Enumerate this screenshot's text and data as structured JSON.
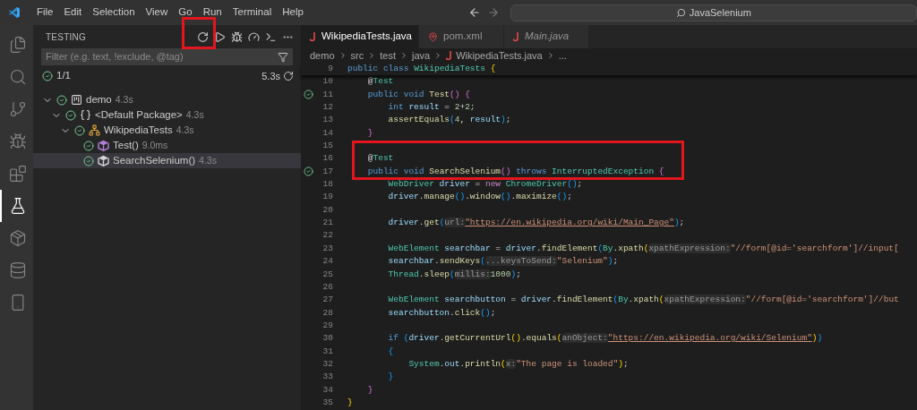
{
  "title_bar": {
    "menu": [
      "File",
      "Edit",
      "Selection",
      "View",
      "Go",
      "Run",
      "Terminal",
      "Help"
    ],
    "command_center": "JavaSelenium"
  },
  "activity_bar": [
    {
      "kind": "explorer",
      "selected": false
    },
    {
      "kind": "search",
      "selected": false
    },
    {
      "kind": "source-control",
      "selected": false
    },
    {
      "kind": "run-debug",
      "selected": false
    },
    {
      "kind": "extensions",
      "selected": false
    },
    {
      "kind": "testing",
      "selected": true
    },
    {
      "kind": "package",
      "selected": false
    },
    {
      "kind": "database",
      "selected": false
    },
    {
      "kind": "device",
      "selected": false
    }
  ],
  "sidebar": {
    "title": "TESTING",
    "actions": [
      {
        "kind": "refresh"
      },
      {
        "kind": "run"
      },
      {
        "kind": "debug"
      },
      {
        "kind": "coverage"
      },
      {
        "kind": "terminal"
      },
      {
        "kind": "more"
      }
    ],
    "filter": {
      "placeholder": "Filter (e.g. text, !exclude, @tag)"
    },
    "summary": {
      "count": "1/1",
      "duration": "5.3s"
    },
    "tree": [
      {
        "kind": "project",
        "label": "demo",
        "duration": "4.3s",
        "passed": true,
        "expanded": true,
        "selected": false,
        "children": [
          {
            "kind": "package",
            "label": "<Default Package>",
            "duration": "4.3s",
            "passed": true,
            "expanded": true,
            "selected": false,
            "children": [
              {
                "kind": "class",
                "label": "WikipediaTests",
                "duration": "4.3s",
                "passed": true,
                "expanded": true,
                "selected": false,
                "children": [
                  {
                    "kind": "method",
                    "label": "Test()",
                    "duration": "9.0ms",
                    "passed": true,
                    "selected": false,
                    "color": "#b180d7"
                  },
                  {
                    "kind": "method",
                    "label": "SearchSelenium()",
                    "duration": "4.3s",
                    "passed": true,
                    "selected": true,
                    "color": "#d4d4d4"
                  }
                ]
              }
            ]
          }
        ]
      }
    ]
  },
  "tabs": [
    {
      "kind": "java",
      "label": "WikipediaTests.java",
      "selected": true,
      "preview": false
    },
    {
      "kind": "xml",
      "label": "pom.xml",
      "selected": false,
      "preview": false
    },
    {
      "kind": "java",
      "label": "Main.java",
      "selected": false,
      "preview": true
    }
  ],
  "breadcrumb": [
    {
      "kind": "folder",
      "label": "demo"
    },
    {
      "kind": "folder",
      "label": "src"
    },
    {
      "kind": "folder",
      "label": "test"
    },
    {
      "kind": "folder",
      "label": "java"
    },
    {
      "kind": "java",
      "label": "WikipediaTests.java"
    },
    {
      "kind": "more",
      "label": "..."
    }
  ],
  "sticky_line": {
    "number": "9",
    "tokens": [
      {
        "kind": "keyword",
        "text": "public"
      },
      {
        "kind": "keyword",
        "text": " class"
      },
      {
        "kind": "type",
        "text": " WikipediaTests"
      },
      {
        "kind": "bracket1",
        "text": " {"
      }
    ]
  },
  "code_lines": [
    {
      "number": "10",
      "passed": false,
      "tokens": [
        {
          "kind": "punct",
          "text": "    @"
        },
        {
          "kind": "type",
          "text": "Test"
        }
      ]
    },
    {
      "number": "11",
      "passed": true,
      "tokens": [
        {
          "kind": "keyword",
          "text": "    public"
        },
        {
          "kind": "keyword",
          "text": " void"
        },
        {
          "kind": "function",
          "text": " Test"
        },
        {
          "kind": "bracket2",
          "text": "()"
        },
        {
          "kind": "bracket2",
          "text": " {"
        }
      ]
    },
    {
      "number": "12",
      "passed": false,
      "tokens": [
        {
          "kind": "keyword",
          "text": "        int"
        },
        {
          "kind": "variable",
          "text": " result"
        },
        {
          "kind": "punct",
          "text": " ="
        },
        {
          "kind": "number",
          "text": " 2"
        },
        {
          "kind": "punct",
          "text": "+"
        },
        {
          "kind": "number",
          "text": "2"
        },
        {
          "kind": "punct",
          "text": ";"
        }
      ]
    },
    {
      "number": "13",
      "passed": false,
      "tokens": [
        {
          "kind": "function",
          "text": "        assertEquals"
        },
        {
          "kind": "bracket3",
          "text": "("
        },
        {
          "kind": "number",
          "text": "4"
        },
        {
          "kind": "punct",
          "text": ","
        },
        {
          "kind": "variable",
          "text": " result"
        },
        {
          "kind": "bracket3",
          "text": ")"
        },
        {
          "kind": "punct",
          "text": ";"
        }
      ]
    },
    {
      "number": "14",
      "passed": false,
      "tokens": [
        {
          "kind": "bracket2",
          "text": "    }"
        }
      ]
    },
    {
      "number": "15",
      "passed": false
    },
    {
      "number": "16",
      "passed": false,
      "tokens": [
        {
          "kind": "punct",
          "text": "    @"
        },
        {
          "kind": "type",
          "text": "Test"
        }
      ]
    },
    {
      "number": "17",
      "passed": true,
      "tokens": [
        {
          "kind": "keyword",
          "text": "    public"
        },
        {
          "kind": "keyword",
          "text": " void"
        },
        {
          "kind": "function",
          "text": " SearchSelenium"
        },
        {
          "kind": "bracket2",
          "text": "()"
        },
        {
          "kind": "keyword",
          "text": " throws"
        },
        {
          "kind": "type",
          "text": " InterruptedException"
        },
        {
          "kind": "bracket2",
          "text": " {"
        }
      ]
    },
    {
      "number": "18",
      "passed": false,
      "tokens": [
        {
          "kind": "type",
          "text": "        WebDriver"
        },
        {
          "kind": "variable",
          "text": " driver"
        },
        {
          "kind": "punct",
          "text": " ="
        },
        {
          "kind": "control",
          "text": " new"
        },
        {
          "kind": "type",
          "text": " ChromeDriver"
        },
        {
          "kind": "bracket3",
          "text": "()"
        },
        {
          "kind": "punct",
          "text": ";"
        }
      ]
    },
    {
      "number": "19",
      "passed": false,
      "tokens": [
        {
          "kind": "variable",
          "text": "        driver"
        },
        {
          "kind": "punct",
          "text": "."
        },
        {
          "kind": "function",
          "text": "manage"
        },
        {
          "kind": "bracket3",
          "text": "()"
        },
        {
          "kind": "punct",
          "text": "."
        },
        {
          "kind": "function",
          "text": "window"
        },
        {
          "kind": "bracket3",
          "text": "()"
        },
        {
          "kind": "punct",
          "text": "."
        },
        {
          "kind": "function",
          "text": "maximize"
        },
        {
          "kind": "bracket3",
          "text": "()"
        },
        {
          "kind": "punct",
          "text": ";"
        }
      ]
    },
    {
      "number": "20",
      "passed": false
    },
    {
      "number": "21",
      "passed": false,
      "tokens": [
        {
          "kind": "variable",
          "text": "        driver"
        },
        {
          "kind": "punct",
          "text": "."
        },
        {
          "kind": "function",
          "text": "get"
        },
        {
          "kind": "bracket3",
          "text": "("
        },
        {
          "kind": "hint",
          "text": "url:"
        },
        {
          "kind": "link",
          "text": "\"https://en.wikipedia.org/wiki/Main_Page\""
        },
        {
          "kind": "bracket3",
          "text": ")"
        },
        {
          "kind": "punct",
          "text": ";"
        }
      ]
    },
    {
      "number": "22",
      "passed": false
    },
    {
      "number": "23",
      "passed": false,
      "tokens": [
        {
          "kind": "type",
          "text": "        WebElement"
        },
        {
          "kind": "variable",
          "text": " searchbar"
        },
        {
          "kind": "punct",
          "text": " ="
        },
        {
          "kind": "variable",
          "text": " driver"
        },
        {
          "kind": "punct",
          "text": "."
        },
        {
          "kind": "function",
          "text": "findElement"
        },
        {
          "kind": "bracket3",
          "text": "("
        },
        {
          "kind": "type",
          "text": "By"
        },
        {
          "kind": "punct",
          "text": "."
        },
        {
          "kind": "function",
          "text": "xpath"
        },
        {
          "kind": "bracket1",
          "text": "("
        },
        {
          "kind": "hint",
          "text": "xpathExpression:"
        },
        {
          "kind": "string",
          "text": "\"//form[@id='searchform']//input["
        }
      ]
    },
    {
      "number": "24",
      "passed": false,
      "tokens": [
        {
          "kind": "variable",
          "text": "        searchbar"
        },
        {
          "kind": "punct",
          "text": "."
        },
        {
          "kind": "function",
          "text": "sendKeys"
        },
        {
          "kind": "bracket3",
          "text": "("
        },
        {
          "kind": "hint",
          "text": "...keysToSend:"
        },
        {
          "kind": "string",
          "text": "\"Selenium\""
        },
        {
          "kind": "bracket3",
          "text": ")"
        },
        {
          "kind": "punct",
          "text": ";"
        }
      ]
    },
    {
      "number": "25",
      "passed": false,
      "tokens": [
        {
          "kind": "type",
          "text": "        Thread"
        },
        {
          "kind": "punct",
          "text": "."
        },
        {
          "kind": "function",
          "text": "sleep"
        },
        {
          "kind": "bracket3",
          "text": "("
        },
        {
          "kind": "hint",
          "text": "millis:"
        },
        {
          "kind": "number",
          "text": "1000"
        },
        {
          "kind": "bracket3",
          "text": ")"
        },
        {
          "kind": "punct",
          "text": ";"
        }
      ]
    },
    {
      "number": "26",
      "passed": false
    },
    {
      "number": "27",
      "passed": false,
      "tokens": [
        {
          "kind": "type",
          "text": "        WebElement"
        },
        {
          "kind": "variable",
          "text": " searchbutton"
        },
        {
          "kind": "punct",
          "text": " ="
        },
        {
          "kind": "variable",
          "text": " driver"
        },
        {
          "kind": "punct",
          "text": "."
        },
        {
          "kind": "function",
          "text": "findElement"
        },
        {
          "kind": "bracket3",
          "text": "("
        },
        {
          "kind": "type",
          "text": "By"
        },
        {
          "kind": "punct",
          "text": "."
        },
        {
          "kind": "function",
          "text": "xpath"
        },
        {
          "kind": "bracket1",
          "text": "("
        },
        {
          "kind": "hint",
          "text": "xpathExpression:"
        },
        {
          "kind": "string",
          "text": "\"//form[@id='searchform']//but"
        }
      ]
    },
    {
      "number": "28",
      "passed": false,
      "tokens": [
        {
          "kind": "variable",
          "text": "        searchbutton"
        },
        {
          "kind": "punct",
          "text": "."
        },
        {
          "kind": "function",
          "text": "click"
        },
        {
          "kind": "bracket3",
          "text": "()"
        },
        {
          "kind": "punct",
          "text": ";"
        }
      ]
    },
    {
      "number": "29",
      "passed": false
    },
    {
      "number": "30",
      "passed": false,
      "tokens": [
        {
          "kind": "keyword",
          "text": "        if"
        },
        {
          "kind": "bracket3",
          "text": " ("
        },
        {
          "kind": "variable",
          "text": "driver"
        },
        {
          "kind": "punct",
          "text": "."
        },
        {
          "kind": "function",
          "text": "getCurrentUrl"
        },
        {
          "kind": "bracket1",
          "text": "()"
        },
        {
          "kind": "punct",
          "text": "."
        },
        {
          "kind": "function",
          "text": "equals"
        },
        {
          "kind": "bracket1",
          "text": "("
        },
        {
          "kind": "hint",
          "text": "anObject:"
        },
        {
          "kind": "link",
          "text": "\"https://en.wikipedia.org/wiki/Selenium\""
        },
        {
          "kind": "bracket1",
          "text": ")"
        },
        {
          "kind": "bracket3",
          "text": ")"
        }
      ]
    },
    {
      "number": "31",
      "passed": false,
      "tokens": [
        {
          "kind": "bracket3",
          "text": "        {"
        }
      ]
    },
    {
      "number": "32",
      "passed": false,
      "tokens": [
        {
          "kind": "type",
          "text": "            System"
        },
        {
          "kind": "punct",
          "text": "."
        },
        {
          "kind": "variable",
          "text": "out"
        },
        {
          "kind": "punct",
          "text": "."
        },
        {
          "kind": "function",
          "text": "println"
        },
        {
          "kind": "bracket1",
          "text": "("
        },
        {
          "kind": "hint",
          "text": "x:"
        },
        {
          "kind": "string",
          "text": "\"The page is loaded\""
        },
        {
          "kind": "bracket1",
          "text": ")"
        },
        {
          "kind": "punct",
          "text": ";"
        }
      ]
    },
    {
      "number": "33",
      "passed": false,
      "tokens": [
        {
          "kind": "bracket3",
          "text": "        }"
        }
      ]
    },
    {
      "number": "34",
      "passed": false,
      "tokens": [
        {
          "kind": "bracket2",
          "text": "    }"
        }
      ]
    },
    {
      "number": "35",
      "passed": false,
      "tokens": [
        {
          "kind": "bracket1",
          "text": "}"
        }
      ]
    }
  ]
}
